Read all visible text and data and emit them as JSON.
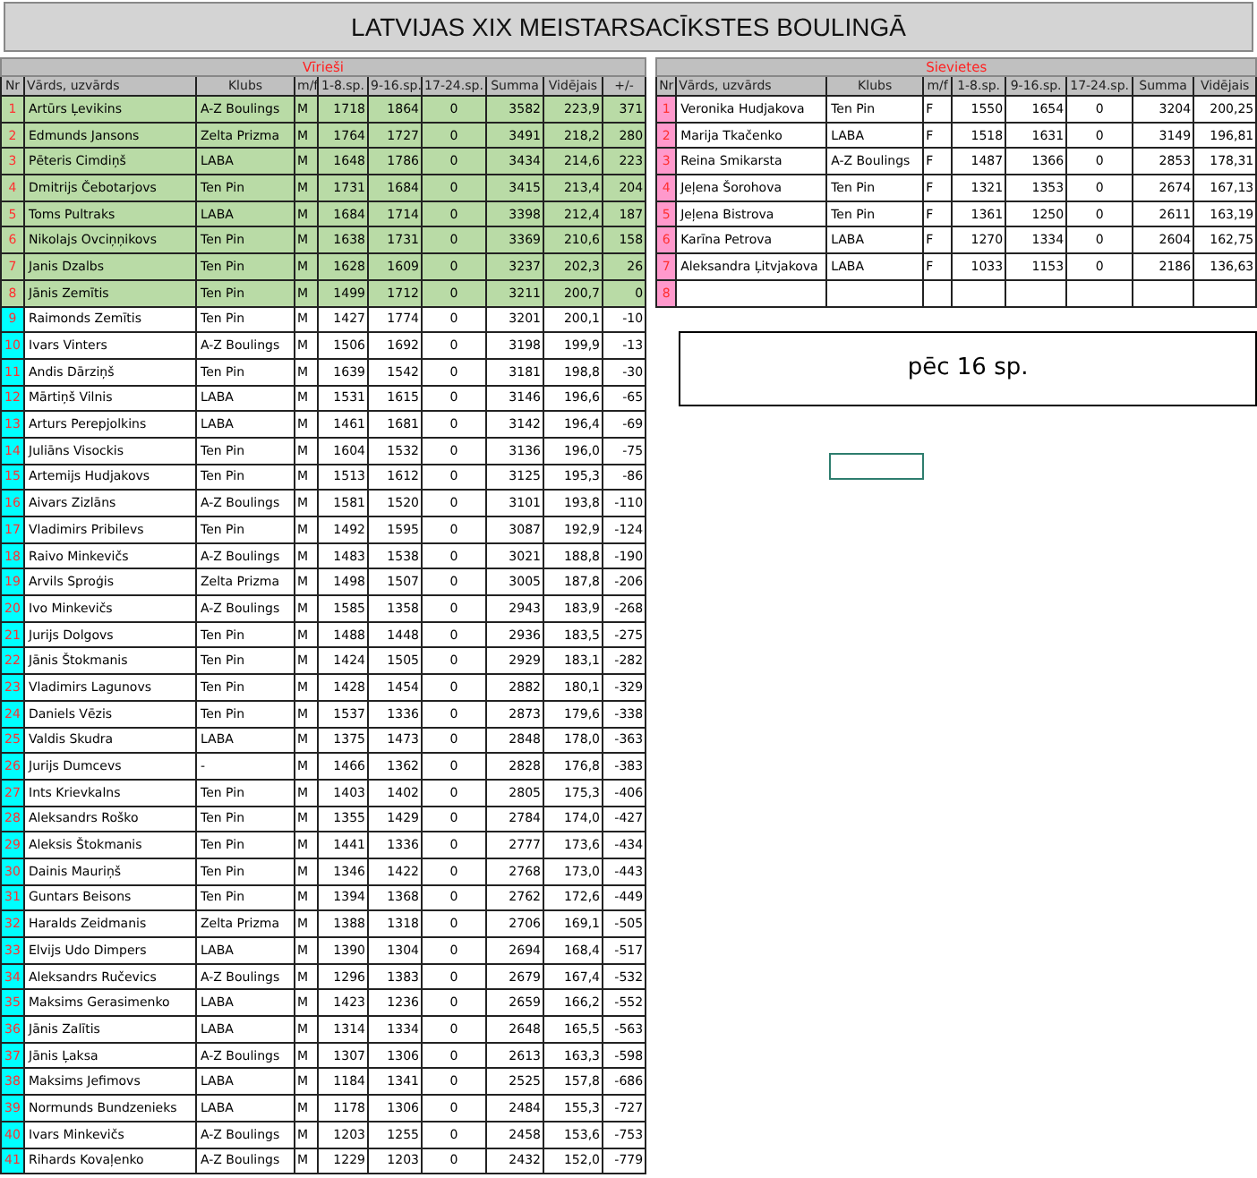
{
  "title": "LATVIJAS XIX MEISTARSACĪKSTES BOULINGĀ",
  "men": {
    "caption": "Vīrieši",
    "columns": [
      "Nr",
      "Vārds, uzvārds",
      "Klubs",
      "m/f",
      "1-8.sp.",
      "9-16.sp.",
      "17-24.sp.",
      "Summa",
      "Vidējais",
      "+/-"
    ],
    "rows": [
      {
        "nr": "1",
        "name": "Artūrs Ļevikins",
        "club": "A-Z Boulings",
        "mf": "M",
        "s1": "1718",
        "s2": "1864",
        "s3": "0",
        "sum": "3582",
        "avg": "223,9",
        "diff": "371",
        "qualified": true
      },
      {
        "nr": "2",
        "name": "Edmunds Jansons",
        "club": "Zelta Prizma",
        "mf": "M",
        "s1": "1764",
        "s2": "1727",
        "s3": "0",
        "sum": "3491",
        "avg": "218,2",
        "diff": "280",
        "qualified": true
      },
      {
        "nr": "3",
        "name": "Pēteris Cimdiņš",
        "club": "LABA",
        "mf": "M",
        "s1": "1648",
        "s2": "1786",
        "s3": "0",
        "sum": "3434",
        "avg": "214,6",
        "diff": "223",
        "qualified": true
      },
      {
        "nr": "4",
        "name": "Dmitrijs Čebotarjovs",
        "club": "Ten Pin",
        "mf": "M",
        "s1": "1731",
        "s2": "1684",
        "s3": "0",
        "sum": "3415",
        "avg": "213,4",
        "diff": "204",
        "qualified": true
      },
      {
        "nr": "5",
        "name": "Toms Pultraks",
        "club": "LABA",
        "mf": "M",
        "s1": "1684",
        "s2": "1714",
        "s3": "0",
        "sum": "3398",
        "avg": "212,4",
        "diff": "187",
        "qualified": true
      },
      {
        "nr": "6",
        "name": "Nikolajs Ovciņņikovs",
        "club": "Ten Pin",
        "mf": "M",
        "s1": "1638",
        "s2": "1731",
        "s3": "0",
        "sum": "3369",
        "avg": "210,6",
        "diff": "158",
        "qualified": true
      },
      {
        "nr": "7",
        "name": "Janis Dzalbs",
        "club": "Ten Pin",
        "mf": "M",
        "s1": "1628",
        "s2": "1609",
        "s3": "0",
        "sum": "3237",
        "avg": "202,3",
        "diff": "26",
        "qualified": true
      },
      {
        "nr": "8",
        "name": "Jānis Zemītis",
        "club": "Ten Pin",
        "mf": "M",
        "s1": "1499",
        "s2": "1712",
        "s3": "0",
        "sum": "3211",
        "avg": "200,7",
        "diff": "0",
        "qualified": true
      },
      {
        "nr": "9",
        "name": "Raimonds Zemītis",
        "club": "Ten Pin",
        "mf": "M",
        "s1": "1427",
        "s2": "1774",
        "s3": "0",
        "sum": "3201",
        "avg": "200,1",
        "diff": "-10",
        "qualified": false
      },
      {
        "nr": "10",
        "name": "Ivars Vinters",
        "club": "A-Z Boulings",
        "mf": "M",
        "s1": "1506",
        "s2": "1692",
        "s3": "0",
        "sum": "3198",
        "avg": "199,9",
        "diff": "-13",
        "qualified": false
      },
      {
        "nr": "11",
        "name": "Andis Dārziņš",
        "club": "Ten Pin",
        "mf": "M",
        "s1": "1639",
        "s2": "1542",
        "s3": "0",
        "sum": "3181",
        "avg": "198,8",
        "diff": "-30",
        "qualified": false
      },
      {
        "nr": "12",
        "name": "Mārtiņš Vilnis",
        "club": "LABA",
        "mf": "M",
        "s1": "1531",
        "s2": "1615",
        "s3": "0",
        "sum": "3146",
        "avg": "196,6",
        "diff": "-65",
        "qualified": false
      },
      {
        "nr": "13",
        "name": "Arturs Perepjolkins",
        "club": "LABA",
        "mf": "M",
        "s1": "1461",
        "s2": "1681",
        "s3": "0",
        "sum": "3142",
        "avg": "196,4",
        "diff": "-69",
        "qualified": false
      },
      {
        "nr": "14",
        "name": "Juliāns Visockis",
        "club": "Ten Pin",
        "mf": "M",
        "s1": "1604",
        "s2": "1532",
        "s3": "0",
        "sum": "3136",
        "avg": "196,0",
        "diff": "-75",
        "qualified": false
      },
      {
        "nr": "15",
        "name": "Artemijs Hudjakovs",
        "club": "Ten Pin",
        "mf": "M",
        "s1": "1513",
        "s2": "1612",
        "s3": "0",
        "sum": "3125",
        "avg": "195,3",
        "diff": "-86",
        "qualified": false
      },
      {
        "nr": "16",
        "name": "Aivars Zizlāns",
        "club": "A-Z Boulings",
        "mf": "M",
        "s1": "1581",
        "s2": "1520",
        "s3": "0",
        "sum": "3101",
        "avg": "193,8",
        "diff": "-110",
        "qualified": false
      },
      {
        "nr": "17",
        "name": "Vladimirs Pribilevs",
        "club": "Ten Pin",
        "mf": "M",
        "s1": "1492",
        "s2": "1595",
        "s3": "0",
        "sum": "3087",
        "avg": "192,9",
        "diff": "-124",
        "qualified": false
      },
      {
        "nr": "18",
        "name": "Raivo Minkevičs",
        "club": "A-Z Boulings",
        "mf": "M",
        "s1": "1483",
        "s2": "1538",
        "s3": "0",
        "sum": "3021",
        "avg": "188,8",
        "diff": "-190",
        "qualified": false
      },
      {
        "nr": "19",
        "name": "Arvils Sproģis",
        "club": "Zelta Prizma",
        "mf": "M",
        "s1": "1498",
        "s2": "1507",
        "s3": "0",
        "sum": "3005",
        "avg": "187,8",
        "diff": "-206",
        "qualified": false
      },
      {
        "nr": "20",
        "name": "Ivo Minkevičs",
        "club": "A-Z Boulings",
        "mf": "M",
        "s1": "1585",
        "s2": "1358",
        "s3": "0",
        "sum": "2943",
        "avg": "183,9",
        "diff": "-268",
        "qualified": false
      },
      {
        "nr": "21",
        "name": "Jurijs Dolgovs",
        "club": "Ten Pin",
        "mf": "M",
        "s1": "1488",
        "s2": "1448",
        "s3": "0",
        "sum": "2936",
        "avg": "183,5",
        "diff": "-275",
        "qualified": false
      },
      {
        "nr": "22",
        "name": "Jānis Štokmanis",
        "club": "Ten Pin",
        "mf": "M",
        "s1": "1424",
        "s2": "1505",
        "s3": "0",
        "sum": "2929",
        "avg": "183,1",
        "diff": "-282",
        "qualified": false
      },
      {
        "nr": "23",
        "name": "Vladimirs Lagunovs",
        "club": "Ten Pin",
        "mf": "M",
        "s1": "1428",
        "s2": "1454",
        "s3": "0",
        "sum": "2882",
        "avg": "180,1",
        "diff": "-329",
        "qualified": false
      },
      {
        "nr": "24",
        "name": "Daniels Vēzis",
        "club": "Ten Pin",
        "mf": "M",
        "s1": "1537",
        "s2": "1336",
        "s3": "0",
        "sum": "2873",
        "avg": "179,6",
        "diff": "-338",
        "qualified": false
      },
      {
        "nr": "25",
        "name": "Valdis Skudra",
        "club": "LABA",
        "mf": "M",
        "s1": "1375",
        "s2": "1473",
        "s3": "0",
        "sum": "2848",
        "avg": "178,0",
        "diff": "-363",
        "qualified": false
      },
      {
        "nr": "26",
        "name": "Jurijs Dumcevs",
        "club": "-",
        "mf": "M",
        "s1": "1466",
        "s2": "1362",
        "s3": "0",
        "sum": "2828",
        "avg": "176,8",
        "diff": "-383",
        "qualified": false
      },
      {
        "nr": "27",
        "name": "Ints Krievkalns",
        "club": "Ten Pin",
        "mf": "M",
        "s1": "1403",
        "s2": "1402",
        "s3": "0",
        "sum": "2805",
        "avg": "175,3",
        "diff": "-406",
        "qualified": false
      },
      {
        "nr": "28",
        "name": "Aleksandrs Roško",
        "club": "Ten Pin",
        "mf": "M",
        "s1": "1355",
        "s2": "1429",
        "s3": "0",
        "sum": "2784",
        "avg": "174,0",
        "diff": "-427",
        "qualified": false
      },
      {
        "nr": "29",
        "name": "Aleksis Štokmanis",
        "club": "Ten Pin",
        "mf": "M",
        "s1": "1441",
        "s2": "1336",
        "s3": "0",
        "sum": "2777",
        "avg": "173,6",
        "diff": "-434",
        "qualified": false
      },
      {
        "nr": "30",
        "name": "Dainis Mauriņš",
        "club": "Ten Pin",
        "mf": "M",
        "s1": "1346",
        "s2": "1422",
        "s3": "0",
        "sum": "2768",
        "avg": "173,0",
        "diff": "-443",
        "qualified": false
      },
      {
        "nr": "31",
        "name": "Guntars Beisons",
        "club": "Ten Pin",
        "mf": "M",
        "s1": "1394",
        "s2": "1368",
        "s3": "0",
        "sum": "2762",
        "avg": "172,6",
        "diff": "-449",
        "qualified": false
      },
      {
        "nr": "32",
        "name": "Haralds Zeidmanis",
        "club": "Zelta Prizma",
        "mf": "M",
        "s1": "1388",
        "s2": "1318",
        "s3": "0",
        "sum": "2706",
        "avg": "169,1",
        "diff": "-505",
        "qualified": false
      },
      {
        "nr": "33",
        "name": "Elvijs Udo Dimpers",
        "club": "LABA",
        "mf": "M",
        "s1": "1390",
        "s2": "1304",
        "s3": "0",
        "sum": "2694",
        "avg": "168,4",
        "diff": "-517",
        "qualified": false
      },
      {
        "nr": "34",
        "name": "Aleksandrs Ručevics",
        "club": "A-Z Boulings",
        "mf": "M",
        "s1": "1296",
        "s2": "1383",
        "s3": "0",
        "sum": "2679",
        "avg": "167,4",
        "diff": "-532",
        "qualified": false
      },
      {
        "nr": "35",
        "name": "Maksims Gerasimenko",
        "club": "LABA",
        "mf": "M",
        "s1": "1423",
        "s2": "1236",
        "s3": "0",
        "sum": "2659",
        "avg": "166,2",
        "diff": "-552",
        "qualified": false
      },
      {
        "nr": "36",
        "name": "Jānis Zalītis",
        "club": "LABA",
        "mf": "M",
        "s1": "1314",
        "s2": "1334",
        "s3": "0",
        "sum": "2648",
        "avg": "165,5",
        "diff": "-563",
        "qualified": false
      },
      {
        "nr": "37",
        "name": "Jānis Ļaksa",
        "club": "A-Z Boulings",
        "mf": "M",
        "s1": "1307",
        "s2": "1306",
        "s3": "0",
        "sum": "2613",
        "avg": "163,3",
        "diff": "-598",
        "qualified": false
      },
      {
        "nr": "38",
        "name": "Maksims Jefimovs",
        "club": "LABA",
        "mf": "M",
        "s1": "1184",
        "s2": "1341",
        "s3": "0",
        "sum": "2525",
        "avg": "157,8",
        "diff": "-686",
        "qualified": false
      },
      {
        "nr": "39",
        "name": "Normunds Bundzenieks",
        "club": "LABA",
        "mf": "M",
        "s1": "1178",
        "s2": "1306",
        "s3": "0",
        "sum": "2484",
        "avg": "155,3",
        "diff": "-727",
        "qualified": false
      },
      {
        "nr": "40",
        "name": "Ivars Minkevičs",
        "club": "A-Z Boulings",
        "mf": "M",
        "s1": "1203",
        "s2": "1255",
        "s3": "0",
        "sum": "2458",
        "avg": "153,6",
        "diff": "-753",
        "qualified": false
      },
      {
        "nr": "41",
        "name": "Rihards Kovaļenko",
        "club": "A-Z Boulings",
        "mf": "M",
        "s1": "1229",
        "s2": "1203",
        "s3": "0",
        "sum": "2432",
        "avg": "152,0",
        "diff": "-779",
        "qualified": false
      }
    ]
  },
  "women": {
    "caption": "Sievietes",
    "columns": [
      "Nr",
      "Vārds, uzvārds",
      "Klubs",
      "m/f",
      "1-8.sp.",
      "9-16.sp.",
      "17-24.sp.",
      "Summa",
      "Vidējais"
    ],
    "rows": [
      {
        "nr": "1",
        "name": "Veronika Hudjakova",
        "club": "Ten Pin",
        "mf": "F",
        "s1": "1550",
        "s2": "1654",
        "s3": "0",
        "sum": "3204",
        "avg": "200,25"
      },
      {
        "nr": "2",
        "name": "Marija Tkačenko",
        "club": "LABA",
        "mf": "F",
        "s1": "1518",
        "s2": "1631",
        "s3": "0",
        "sum": "3149",
        "avg": "196,81"
      },
      {
        "nr": "3",
        "name": "Reina Smikarsta",
        "club": "A-Z Boulings",
        "mf": "F",
        "s1": "1487",
        "s2": "1366",
        "s3": "0",
        "sum": "2853",
        "avg": "178,31"
      },
      {
        "nr": "4",
        "name": "Jeļena Šorohova",
        "club": "Ten Pin",
        "mf": "F",
        "s1": "1321",
        "s2": "1353",
        "s3": "0",
        "sum": "2674",
        "avg": "167,13"
      },
      {
        "nr": "5",
        "name": "Jeļena Bistrova",
        "club": "Ten Pin",
        "mf": "F",
        "s1": "1361",
        "s2": "1250",
        "s3": "0",
        "sum": "2611",
        "avg": "163,19"
      },
      {
        "nr": "6",
        "name": "Karīna Petrova",
        "club": "LABA",
        "mf": "F",
        "s1": "1270",
        "s2": "1334",
        "s3": "0",
        "sum": "2604",
        "avg": "162,75"
      },
      {
        "nr": "7",
        "name": "Aleksandra Ļitvjakova",
        "club": "LABA",
        "mf": "F",
        "s1": "1033",
        "s2": "1153",
        "s3": "0",
        "sum": "2186",
        "avg": "136,63"
      },
      {
        "nr": "8"
      }
    ]
  },
  "note": "pēc 16 sp."
}
